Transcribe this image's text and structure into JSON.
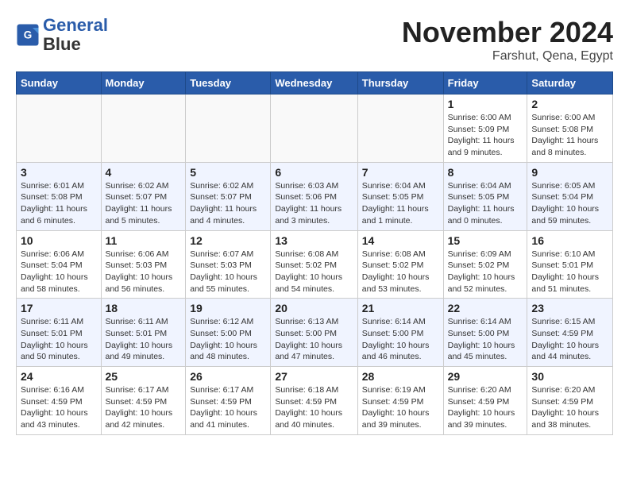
{
  "logo": {
    "line1": "General",
    "line2": "Blue"
  },
  "title": "November 2024",
  "location": "Farshut, Qena, Egypt",
  "weekdays": [
    "Sunday",
    "Monday",
    "Tuesday",
    "Wednesday",
    "Thursday",
    "Friday",
    "Saturday"
  ],
  "weeks": [
    [
      {
        "day": "",
        "info": ""
      },
      {
        "day": "",
        "info": ""
      },
      {
        "day": "",
        "info": ""
      },
      {
        "day": "",
        "info": ""
      },
      {
        "day": "",
        "info": ""
      },
      {
        "day": "1",
        "info": "Sunrise: 6:00 AM\nSunset: 5:09 PM\nDaylight: 11 hours and 9 minutes."
      },
      {
        "day": "2",
        "info": "Sunrise: 6:00 AM\nSunset: 5:08 PM\nDaylight: 11 hours and 8 minutes."
      }
    ],
    [
      {
        "day": "3",
        "info": "Sunrise: 6:01 AM\nSunset: 5:08 PM\nDaylight: 11 hours and 6 minutes."
      },
      {
        "day": "4",
        "info": "Sunrise: 6:02 AM\nSunset: 5:07 PM\nDaylight: 11 hours and 5 minutes."
      },
      {
        "day": "5",
        "info": "Sunrise: 6:02 AM\nSunset: 5:07 PM\nDaylight: 11 hours and 4 minutes."
      },
      {
        "day": "6",
        "info": "Sunrise: 6:03 AM\nSunset: 5:06 PM\nDaylight: 11 hours and 3 minutes."
      },
      {
        "day": "7",
        "info": "Sunrise: 6:04 AM\nSunset: 5:05 PM\nDaylight: 11 hours and 1 minute."
      },
      {
        "day": "8",
        "info": "Sunrise: 6:04 AM\nSunset: 5:05 PM\nDaylight: 11 hours and 0 minutes."
      },
      {
        "day": "9",
        "info": "Sunrise: 6:05 AM\nSunset: 5:04 PM\nDaylight: 10 hours and 59 minutes."
      }
    ],
    [
      {
        "day": "10",
        "info": "Sunrise: 6:06 AM\nSunset: 5:04 PM\nDaylight: 10 hours and 58 minutes."
      },
      {
        "day": "11",
        "info": "Sunrise: 6:06 AM\nSunset: 5:03 PM\nDaylight: 10 hours and 56 minutes."
      },
      {
        "day": "12",
        "info": "Sunrise: 6:07 AM\nSunset: 5:03 PM\nDaylight: 10 hours and 55 minutes."
      },
      {
        "day": "13",
        "info": "Sunrise: 6:08 AM\nSunset: 5:02 PM\nDaylight: 10 hours and 54 minutes."
      },
      {
        "day": "14",
        "info": "Sunrise: 6:08 AM\nSunset: 5:02 PM\nDaylight: 10 hours and 53 minutes."
      },
      {
        "day": "15",
        "info": "Sunrise: 6:09 AM\nSunset: 5:02 PM\nDaylight: 10 hours and 52 minutes."
      },
      {
        "day": "16",
        "info": "Sunrise: 6:10 AM\nSunset: 5:01 PM\nDaylight: 10 hours and 51 minutes."
      }
    ],
    [
      {
        "day": "17",
        "info": "Sunrise: 6:11 AM\nSunset: 5:01 PM\nDaylight: 10 hours and 50 minutes."
      },
      {
        "day": "18",
        "info": "Sunrise: 6:11 AM\nSunset: 5:01 PM\nDaylight: 10 hours and 49 minutes."
      },
      {
        "day": "19",
        "info": "Sunrise: 6:12 AM\nSunset: 5:00 PM\nDaylight: 10 hours and 48 minutes."
      },
      {
        "day": "20",
        "info": "Sunrise: 6:13 AM\nSunset: 5:00 PM\nDaylight: 10 hours and 47 minutes."
      },
      {
        "day": "21",
        "info": "Sunrise: 6:14 AM\nSunset: 5:00 PM\nDaylight: 10 hours and 46 minutes."
      },
      {
        "day": "22",
        "info": "Sunrise: 6:14 AM\nSunset: 5:00 PM\nDaylight: 10 hours and 45 minutes."
      },
      {
        "day": "23",
        "info": "Sunrise: 6:15 AM\nSunset: 4:59 PM\nDaylight: 10 hours and 44 minutes."
      }
    ],
    [
      {
        "day": "24",
        "info": "Sunrise: 6:16 AM\nSunset: 4:59 PM\nDaylight: 10 hours and 43 minutes."
      },
      {
        "day": "25",
        "info": "Sunrise: 6:17 AM\nSunset: 4:59 PM\nDaylight: 10 hours and 42 minutes."
      },
      {
        "day": "26",
        "info": "Sunrise: 6:17 AM\nSunset: 4:59 PM\nDaylight: 10 hours and 41 minutes."
      },
      {
        "day": "27",
        "info": "Sunrise: 6:18 AM\nSunset: 4:59 PM\nDaylight: 10 hours and 40 minutes."
      },
      {
        "day": "28",
        "info": "Sunrise: 6:19 AM\nSunset: 4:59 PM\nDaylight: 10 hours and 39 minutes."
      },
      {
        "day": "29",
        "info": "Sunrise: 6:20 AM\nSunset: 4:59 PM\nDaylight: 10 hours and 39 minutes."
      },
      {
        "day": "30",
        "info": "Sunrise: 6:20 AM\nSunset: 4:59 PM\nDaylight: 10 hours and 38 minutes."
      }
    ]
  ]
}
